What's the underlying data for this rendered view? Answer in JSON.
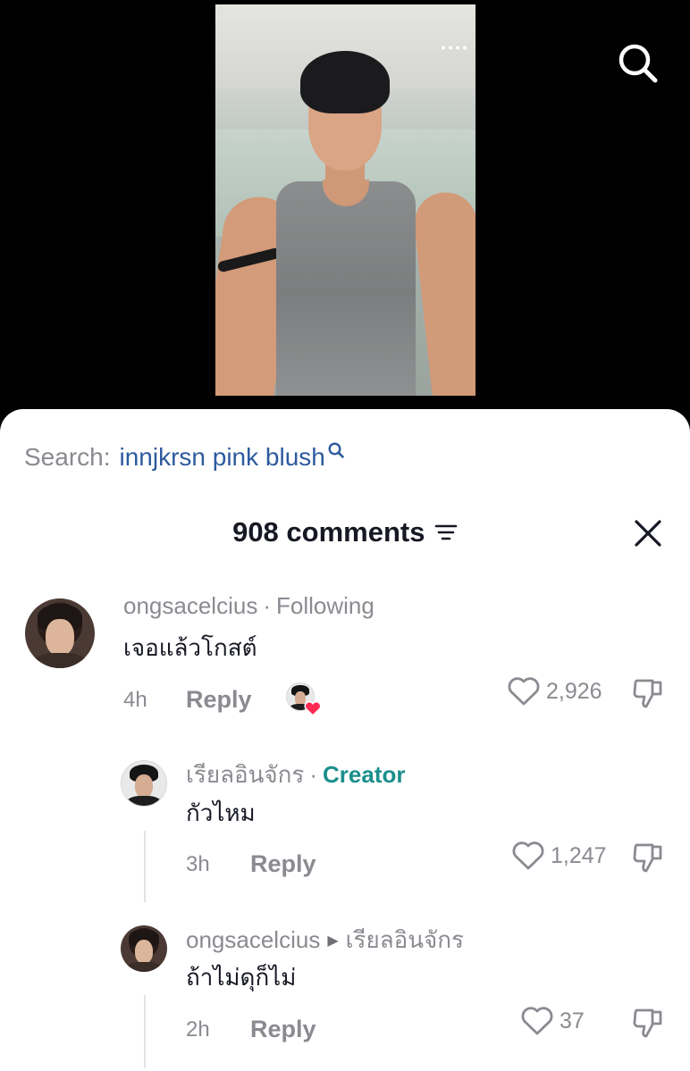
{
  "header": {
    "search_icon": "search-icon"
  },
  "sheet": {
    "search_label": "Search:",
    "search_term": "innjkrsn pink blush",
    "comments_count": "908 comments",
    "sort_icon": "sort-icon",
    "close_icon": "close-icon"
  },
  "comments": [
    {
      "username": "ongsacelcius",
      "tag": "Following",
      "text": "เจอแล้วโกสต์",
      "time": "4h",
      "reply_label": "Reply",
      "likes": "2,926",
      "liked_by_creator": true
    },
    {
      "username": "เรียลอินจักร",
      "tag": "Creator",
      "text": "กัวไหม",
      "time": "3h",
      "reply_label": "Reply",
      "likes": "1,247"
    },
    {
      "username": "ongsacelcius",
      "reply_to": "เรียลอินจักร",
      "text": "ถ้าไม่ดุก็ไม่",
      "time": "2h",
      "reply_label": "Reply",
      "likes": "37"
    }
  ],
  "colors": {
    "search_term": "#2c5a9e",
    "creator_tag": "#1b8f8c",
    "muted": "#8a8b91",
    "heart_badge": "#fe2c55"
  }
}
